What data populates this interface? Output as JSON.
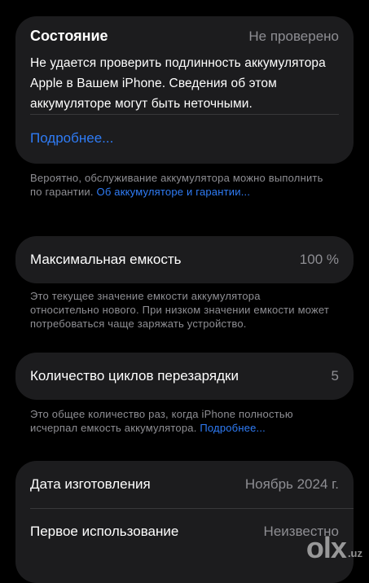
{
  "status": {
    "title": "Состояние",
    "value": "Не проверено",
    "message": "Не удается проверить подлинность аккумулятора Apple в Вашем iPhone. Сведения об этом аккумуляторе могут быть неточными.",
    "link": "Подробнее..."
  },
  "warranty_note": {
    "text": "Вероятно, обслуживание аккумулятора можно выполнить по гарантии. ",
    "link": "Об аккумуляторе и гарантии..."
  },
  "capacity": {
    "label": "Максимальная емкость",
    "value": "100 %",
    "note": "Это текущее значение емкости аккумулятора относительно нового. При низком значении емкости может потребоваться чаще заряжать устройство."
  },
  "cycles": {
    "label": "Количество циклов перезарядки",
    "value": "5",
    "note": "Это общее количество раз, когда iPhone полностью исчерпал емкость аккумулятора. ",
    "link": "Подробнее..."
  },
  "info": {
    "manufacture_label": "Дата изготовления",
    "manufacture_value": "Ноябрь 2024 г.",
    "first_use_label": "Первое использование",
    "first_use_value": "Неизвестно"
  },
  "watermark": {
    "logo": "olx",
    "domain": ".uz"
  },
  "colors": {
    "background": "#000000",
    "card": "#1c1c1e",
    "secondary_text": "#8e8e93",
    "link": "#2f7cf6"
  }
}
